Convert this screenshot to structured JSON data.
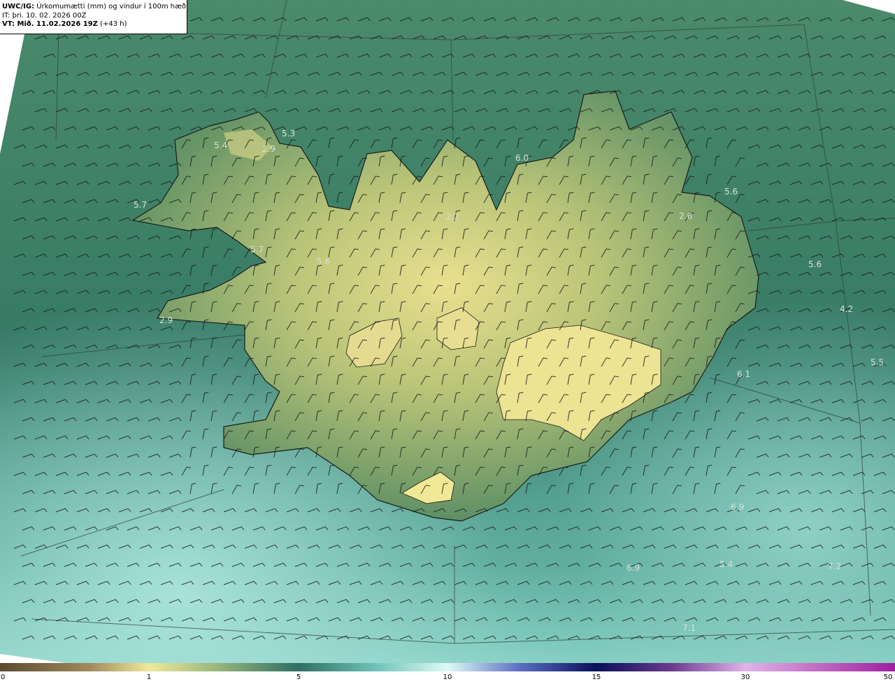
{
  "header": {
    "model": "UWC/IG:",
    "title": "Úrkomumætti (mm) og vindur í 100m hæð",
    "init_time": "IT: þri. 10. 02. 2026 00Z",
    "valid_prefix": "VT: Mið. 11.02.2026 19Z",
    "valid_suffix": "(+43 h)"
  },
  "colorbar": {
    "ticks": [
      "0",
      "1",
      "5",
      "10",
      "15",
      "30",
      "50"
    ],
    "colors": [
      "#5c4a32",
      "#b8a46a",
      "#efe99a",
      "#6aa07c",
      "#2f6e62",
      "#7fd8d2",
      "#dffaf6",
      "#1b1f7a",
      "#0a0f5a",
      "#e0b4e8",
      "#a01e9e"
    ]
  },
  "map_values": [
    "5.4",
    "5.3",
    "2.9",
    "5.7",
    "5.7",
    "5.6",
    "6.0",
    "5.6",
    "2.6",
    "2.2",
    "2.9",
    "5.6",
    "4.2",
    "5.5",
    "6.1",
    "6.9",
    "6.9",
    "5.4",
    "7.2",
    "7.1"
  ]
}
